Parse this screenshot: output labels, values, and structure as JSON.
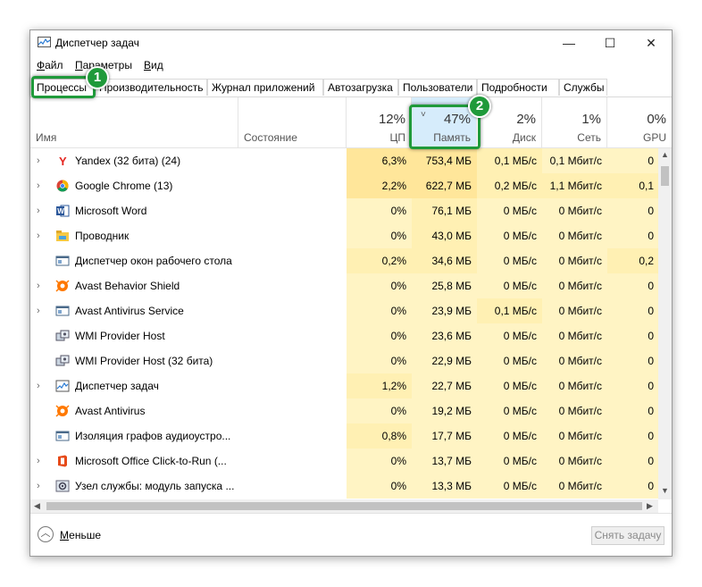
{
  "window": {
    "title": "Диспетчер задач",
    "minimize": "—",
    "maximize": "☐",
    "close": "✕"
  },
  "menu": {
    "file_u": "Ф",
    "file_rest": "айл",
    "params_u": "П",
    "params_rest": "араметры",
    "view_u": "В",
    "view_rest": "ид"
  },
  "tabs": [
    "Процессы",
    "Производительность",
    "Журнал приложений",
    "Автозагрузка",
    "Пользователи",
    "Подробности",
    "Службы"
  ],
  "header": {
    "name": "Имя",
    "status": "Состояние",
    "cpu": {
      "pct": "12%",
      "label": "ЦП"
    },
    "mem": {
      "pct": "47%",
      "label": "Память",
      "sort": "˅"
    },
    "disk": {
      "pct": "2%",
      "label": "Диск"
    },
    "net": {
      "pct": "1%",
      "label": "Сеть"
    },
    "gpu": {
      "pct": "0%",
      "label": "GPU"
    }
  },
  "processes": [
    {
      "expand": "›",
      "icon": "yandex-icon",
      "name": "Yandex (32 бита) (24)",
      "cpu": "6,3%",
      "mem": "753,4 МБ",
      "disk": "0,1 МБ/с",
      "net": "0,1 Мбит/с",
      "gpu": "0"
    },
    {
      "expand": "›",
      "icon": "chrome-icon",
      "name": "Google Chrome (13)",
      "cpu": "2,2%",
      "mem": "622,7 МБ",
      "disk": "0,2 МБ/с",
      "net": "1,1 Мбит/с",
      "gpu": "0,1"
    },
    {
      "expand": "›",
      "icon": "word-icon",
      "name": "Microsoft Word",
      "cpu": "0%",
      "mem": "76,1 МБ",
      "disk": "0 МБ/с",
      "net": "0 Мбит/с",
      "gpu": "0"
    },
    {
      "expand": "›",
      "icon": "explorer-icon",
      "name": "Проводник",
      "cpu": "0%",
      "mem": "43,0 МБ",
      "disk": "0 МБ/с",
      "net": "0 Мбит/с",
      "gpu": "0"
    },
    {
      "expand": "",
      "icon": "window-icon",
      "name": "Диспетчер окон рабочего стола",
      "cpu": "0,2%",
      "mem": "34,6 МБ",
      "disk": "0 МБ/с",
      "net": "0 Мбит/с",
      "gpu": "0,2"
    },
    {
      "expand": "›",
      "icon": "avast-icon",
      "name": "Avast Behavior Shield",
      "cpu": "0%",
      "mem": "25,8 МБ",
      "disk": "0 МБ/с",
      "net": "0 Мбит/с",
      "gpu": "0"
    },
    {
      "expand": "›",
      "icon": "window-icon",
      "name": "Avast Antivirus  Service",
      "cpu": "0%",
      "mem": "23,9 МБ",
      "disk": "0,1 МБ/с",
      "net": "0 Мбит/с",
      "gpu": "0"
    },
    {
      "expand": "",
      "icon": "wmi-icon",
      "name": "WMI Provider Host",
      "cpu": "0%",
      "mem": "23,6 МБ",
      "disk": "0 МБ/с",
      "net": "0 Мбит/с",
      "gpu": "0"
    },
    {
      "expand": "",
      "icon": "wmi-icon",
      "name": "WMI Provider Host (32 бита)",
      "cpu": "0%",
      "mem": "22,9 МБ",
      "disk": "0 МБ/с",
      "net": "0 Мбит/с",
      "gpu": "0"
    },
    {
      "expand": "›",
      "icon": "taskmgr-icon",
      "name": "Диспетчер задач",
      "cpu": "1,2%",
      "mem": "22,7 МБ",
      "disk": "0 МБ/с",
      "net": "0 Мбит/с",
      "gpu": "0"
    },
    {
      "expand": "",
      "icon": "avast-icon",
      "name": "Avast Antivirus",
      "cpu": "0%",
      "mem": "19,2 МБ",
      "disk": "0 МБ/с",
      "net": "0 Мбит/с",
      "gpu": "0"
    },
    {
      "expand": "",
      "icon": "window-icon",
      "name": "Изоляция графов аудиоустро...",
      "cpu": "0,8%",
      "mem": "17,7 МБ",
      "disk": "0 МБ/с",
      "net": "0 Мбит/с",
      "gpu": "0"
    },
    {
      "expand": "›",
      "icon": "office-icon",
      "name": "Microsoft Office Click-to-Run (...",
      "cpu": "0%",
      "mem": "13,7 МБ",
      "disk": "0 МБ/с",
      "net": "0 Мбит/с",
      "gpu": "0"
    },
    {
      "expand": "›",
      "icon": "service-icon",
      "name": "Узел службы: модуль запуска ...",
      "cpu": "0%",
      "mem": "13,3 МБ",
      "disk": "0 МБ/с",
      "net": "0 Мбит/с",
      "gpu": "0"
    }
  ],
  "footer": {
    "less_icon": "︿",
    "less_u": "М",
    "less_rest": "еньше",
    "end_task": "Снять задачу"
  },
  "annotations": [
    "1",
    "2"
  ],
  "colors": {
    "heat_light": "#fff4c4",
    "heat_mid": "#fff0b3",
    "heat_strong": "#ffe69a",
    "mem_header": "#d6ecfb",
    "highlight": "#1f9a3a"
  }
}
